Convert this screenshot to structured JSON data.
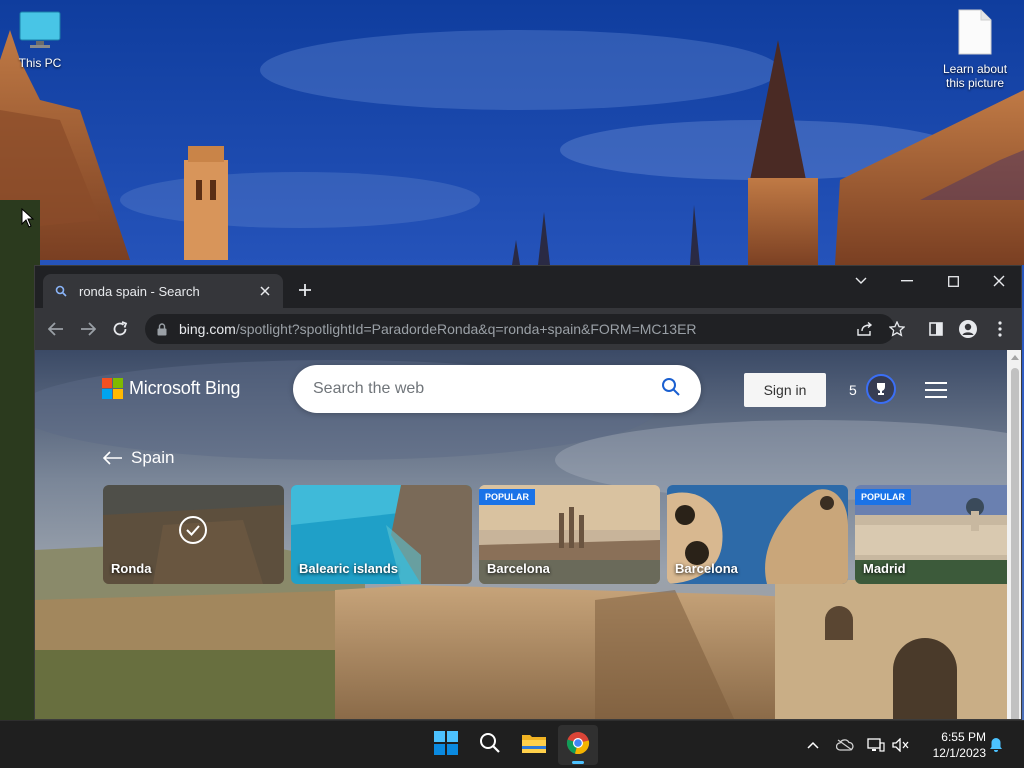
{
  "desktop": {
    "icons": [
      {
        "label": "This PC"
      },
      {
        "label_line1": "Learn about",
        "label_line2": "this picture"
      }
    ]
  },
  "browser": {
    "tab": {
      "title": "ronda spain - Search"
    },
    "address": {
      "host": "bing.com",
      "path": "/spotlight?spotlightId=ParadordeRonda&q=ronda+spain&FORM=MC13ER"
    }
  },
  "bing": {
    "logo_text": "Microsoft Bing",
    "search_placeholder": "Search the web",
    "signin_label": "Sign in",
    "points": "5",
    "back_label": "Spain",
    "cards": [
      {
        "label": "Ronda",
        "selected": true,
        "badge": ""
      },
      {
        "label": "Balearic islands",
        "selected": false,
        "badge": ""
      },
      {
        "label": "Barcelona",
        "selected": false,
        "badge": "POPULAR"
      },
      {
        "label": "Barcelona",
        "selected": false,
        "badge": ""
      },
      {
        "label": "Madrid",
        "selected": false,
        "badge": "POPULAR"
      }
    ]
  },
  "taskbar": {
    "apps": [
      "start-icon",
      "search-icon",
      "file-explorer-icon",
      "chrome-icon"
    ],
    "clock": {
      "time": "6:55 PM",
      "date": "12/1/2023"
    }
  },
  "colors": {
    "accent_blue": "#1a73e8",
    "chrome_dark": "#202124",
    "chrome_toolbar": "#35363a",
    "taskbar": "#1f1f1f"
  }
}
